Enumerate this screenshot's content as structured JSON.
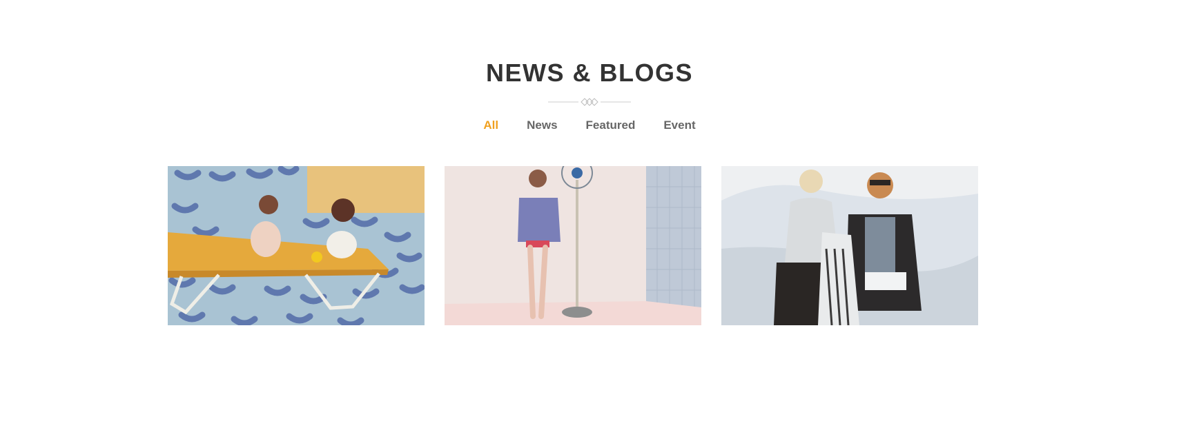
{
  "section": {
    "title": "NEWS & BLOGS"
  },
  "filters": [
    {
      "label": "All",
      "active": true
    },
    {
      "label": "News",
      "active": false
    },
    {
      "label": "Featured",
      "active": false
    },
    {
      "label": "Event",
      "active": false
    }
  ],
  "colors": {
    "accent": "#f0a01e",
    "title": "#333333",
    "filter": "#666666"
  },
  "posts": [
    {
      "image": "kids-on-lounger-photo"
    },
    {
      "image": "girl-by-fan-photo"
    },
    {
      "image": "two-women-on-beach-photo"
    }
  ]
}
